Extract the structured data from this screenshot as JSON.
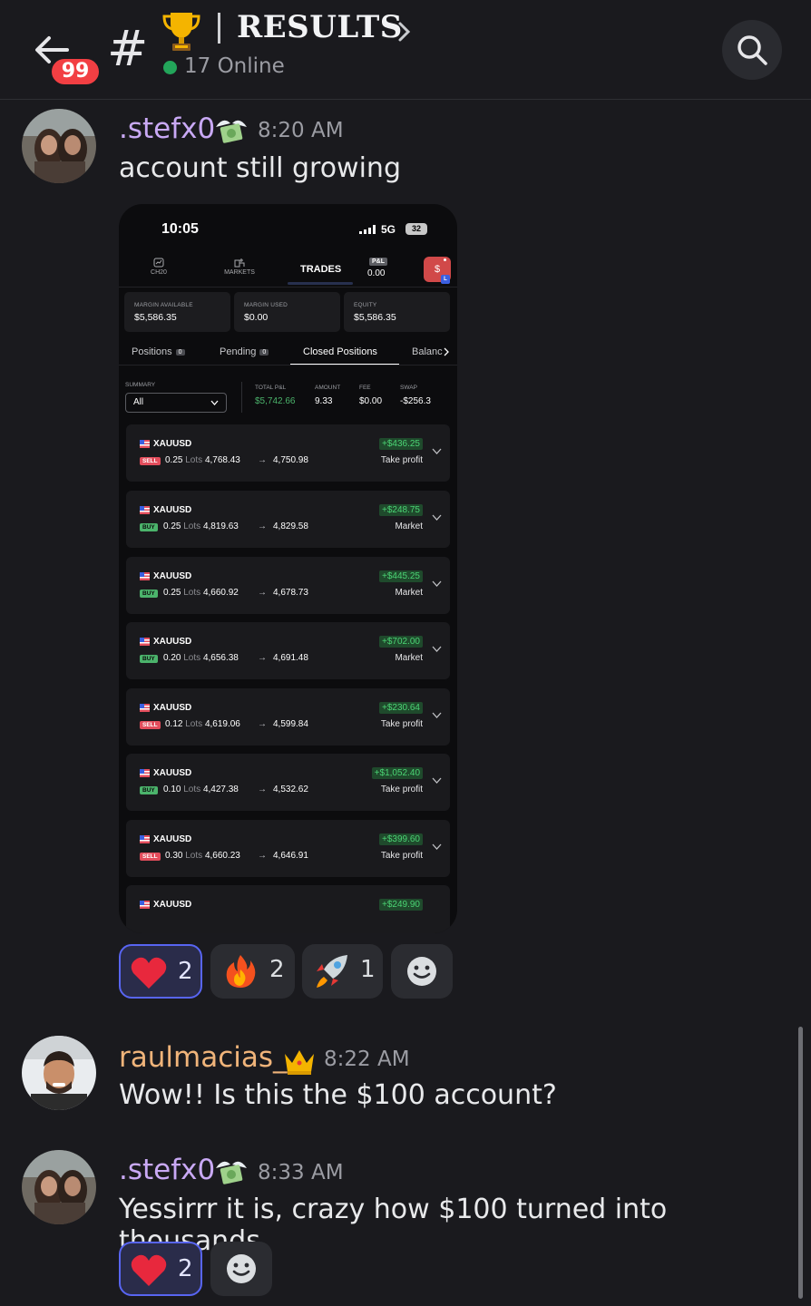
{
  "header": {
    "unread_badge": "99",
    "hash_symbol": "#",
    "channel_name": "RESULTS",
    "online_text": "17 Online"
  },
  "messages": [
    {
      "username": ".stefx0",
      "username_color": "#c9a9f5",
      "time": "8:20 AM",
      "text": "account still growing"
    },
    {
      "username": "raulmacias_",
      "username_color": "#f0b47a",
      "time": "8:22 AM",
      "text": "Wow!! Is this the $100 account?"
    },
    {
      "username": ".stefx0",
      "username_color": "#c9a9f5",
      "time": "8:33 AM",
      "text": "Yessirrr it is, crazy how $100 turned into thousands"
    }
  ],
  "phone": {
    "clock": "10:05",
    "network": "5G",
    "battery": "32",
    "tabs": {
      "ch20": "CH20",
      "markets": "MARKETS",
      "trades": "TRADES",
      "pl_label": "P&L",
      "pl_value": "0.00",
      "dollar": "$",
      "l_badge": "L"
    },
    "metrics": [
      {
        "label": "MARGIN AVAILABLE",
        "value": "$5,586.35"
      },
      {
        "label": "MARGIN USED",
        "value": "$0.00"
      },
      {
        "label": "EQUITY",
        "value": "$5,586.35"
      }
    ],
    "subtabs": {
      "positions": "Positions",
      "positions_count": "0",
      "pending": "Pending",
      "pending_count": "0",
      "closed": "Closed Positions",
      "balance": "Balanc"
    },
    "summary": {
      "label": "SUMMARY",
      "selected": "All",
      "total_pl_label": "TOTAL P&L",
      "total_pl": "$5,742.66",
      "amount_label": "AMOUNT",
      "amount": "9.33",
      "fee_label": "FEE",
      "fee": "$0.00",
      "swap_label": "SWAP",
      "swap": "-$256.3"
    },
    "trades": [
      {
        "symbol": "XAUUSD",
        "side": "SELL",
        "lots": "0.25",
        "lots_unit": "Lots",
        "from": "4,768.43",
        "to": "4,750.98",
        "pl": "+$436.25",
        "close": "Take profit"
      },
      {
        "symbol": "XAUUSD",
        "side": "BUY",
        "lots": "0.25",
        "lots_unit": "Lots",
        "from": "4,819.63",
        "to": "4,829.58",
        "pl": "+$248.75",
        "close": "Market"
      },
      {
        "symbol": "XAUUSD",
        "side": "BUY",
        "lots": "0.25",
        "lots_unit": "Lots",
        "from": "4,660.92",
        "to": "4,678.73",
        "pl": "+$445.25",
        "close": "Market"
      },
      {
        "symbol": "XAUUSD",
        "side": "BUY",
        "lots": "0.20",
        "lots_unit": "Lots",
        "from": "4,656.38",
        "to": "4,691.48",
        "pl": "+$702.00",
        "close": "Market"
      },
      {
        "symbol": "XAUUSD",
        "side": "SELL",
        "lots": "0.12",
        "lots_unit": "Lots",
        "from": "4,619.06",
        "to": "4,599.84",
        "pl": "+$230.64",
        "close": "Take profit"
      },
      {
        "symbol": "XAUUSD",
        "side": "BUY",
        "lots": "0.10",
        "lots_unit": "Lots",
        "from": "4,427.38",
        "to": "4,532.62",
        "pl": "+$1,052.40",
        "close": "Take profit"
      },
      {
        "symbol": "XAUUSD",
        "side": "SELL",
        "lots": "0.30",
        "lots_unit": "Lots",
        "from": "4,660.23",
        "to": "4,646.91",
        "pl": "+$399.60",
        "close": "Take profit"
      },
      {
        "symbol": "XAUUSD",
        "pl": "+$249.90"
      }
    ]
  },
  "reactions_1": [
    {
      "emoji": "heart",
      "count": "2",
      "active": true
    },
    {
      "emoji": "fire",
      "count": "2",
      "active": false
    },
    {
      "emoji": "rocket",
      "count": "1",
      "active": false
    }
  ],
  "reactions_2": [
    {
      "emoji": "heart",
      "count": "2",
      "active": true
    }
  ],
  "icons": {
    "back": "back-arrow-icon",
    "search": "search-icon",
    "trophy": "trophy-icon",
    "money": "money-wings-icon",
    "crown": "crown-icon",
    "add_reaction": "add-reaction-icon"
  },
  "colors": {
    "background": "#1a1a1e",
    "online_green": "#23a55a",
    "badge_red": "#f23f43",
    "reaction_active_border": "#5865f2",
    "profit_green": "#4bd474"
  }
}
